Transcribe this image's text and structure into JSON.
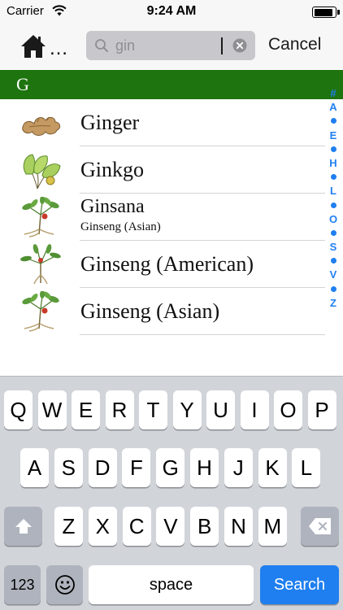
{
  "status_bar": {
    "carrier": "Carrier",
    "time": "9:24 AM",
    "battery_level": 0.92
  },
  "nav": {
    "home_ellipsis": "…",
    "search": {
      "value": "gin",
      "icon": "search-icon"
    },
    "cancel_label": "Cancel"
  },
  "section": {
    "letter": "G",
    "color": "#1e740f"
  },
  "items": [
    {
      "title": "Ginger",
      "subtitle": "",
      "thumb": "ginger-root-illustration"
    },
    {
      "title": "Ginkgo",
      "subtitle": "",
      "thumb": "ginkgo-leaf-illustration"
    },
    {
      "title": "Ginsana",
      "subtitle": "Ginseng (Asian)",
      "thumb": "ginseng-plant-illustration"
    },
    {
      "title": "Ginseng (American)",
      "subtitle": "",
      "thumb": "american-ginseng-illustration"
    },
    {
      "title": "Ginseng (Asian)",
      "subtitle": "",
      "thumb": "ginseng-plant-illustration"
    }
  ],
  "index": [
    "#",
    "A",
    "•",
    "E",
    "•",
    "H",
    "•",
    "L",
    "•",
    "O",
    "•",
    "S",
    "•",
    "V",
    "•",
    "Z"
  ],
  "keyboard": {
    "row1": [
      "Q",
      "W",
      "E",
      "R",
      "T",
      "Y",
      "U",
      "I",
      "O",
      "P"
    ],
    "row2": [
      "A",
      "S",
      "D",
      "F",
      "G",
      "H",
      "J",
      "K",
      "L"
    ],
    "row3": [
      "Z",
      "X",
      "C",
      "V",
      "B",
      "N",
      "M"
    ],
    "numbers_label": "123",
    "space_label": "space",
    "search_label": "Search",
    "accent": "#1f7ff0"
  }
}
